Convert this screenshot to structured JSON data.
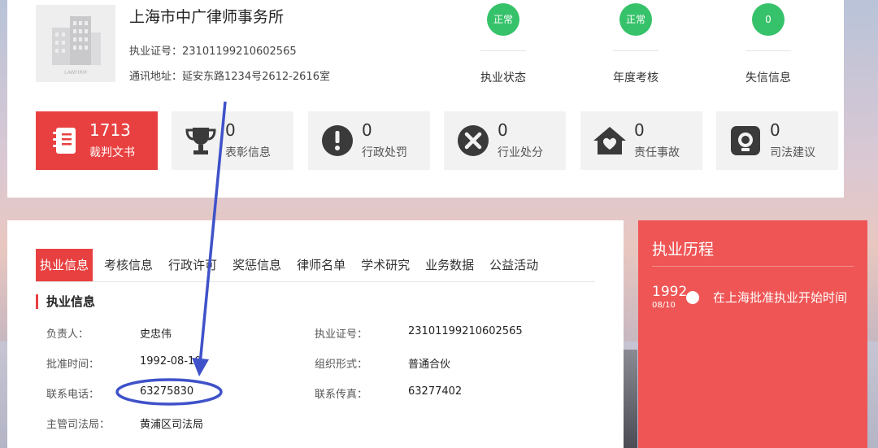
{
  "firm": {
    "name": "上海市中广律师事务所",
    "license_label": "执业证号：",
    "license_no": "23101199210602565",
    "address_label": "通讯地址：",
    "address": "延安东路1234号2612-2616室",
    "logo_text": "LAWFIRM"
  },
  "status": [
    {
      "value": "正常",
      "label": "执业状态"
    },
    {
      "value": "正常",
      "label": "年度考核"
    },
    {
      "value": "0",
      "label": "失信信息"
    }
  ],
  "stats": [
    {
      "count": "1713",
      "label": "裁判文书",
      "icon": "notebook-icon"
    },
    {
      "count": "0",
      "label": "表彰信息",
      "icon": "trophy-icon"
    },
    {
      "count": "0",
      "label": "行政处罚",
      "icon": "exclamation-icon"
    },
    {
      "count": "0",
      "label": "行业处分",
      "icon": "x-circle-icon"
    },
    {
      "count": "0",
      "label": "责任事故",
      "icon": "house-heart-icon"
    },
    {
      "count": "0",
      "label": "司法建议",
      "icon": "bulb-icon"
    }
  ],
  "tabs": [
    "执业信息",
    "考核信息",
    "行政许可",
    "奖惩信息",
    "律师名单",
    "学术研究",
    "业务数据",
    "公益活动"
  ],
  "section_title": "执业信息",
  "info": {
    "leader_label": "负责人：",
    "leader": "史忠伟",
    "license_label": "执业证号：",
    "license": "23101199210602565",
    "approve_label": "批准时间：",
    "approve": "1992-08-10",
    "org_label": "组织形式：",
    "org": "普通合伙",
    "phone_label": "联系电话：",
    "phone": "63275830",
    "fax_label": "联系传真：",
    "fax": "63277402",
    "bureau_label": "主管司法局：",
    "bureau": "黄浦区司法局"
  },
  "timeline": {
    "title": "执业历程",
    "year": "1992",
    "date": "08/10",
    "text": "在上海批准执业开始时间"
  },
  "colors": {
    "accent": "#e84040",
    "status_green": "#36c26a",
    "timeline_bg": "#ef5555",
    "annotation_blue": "#3f52c9"
  }
}
